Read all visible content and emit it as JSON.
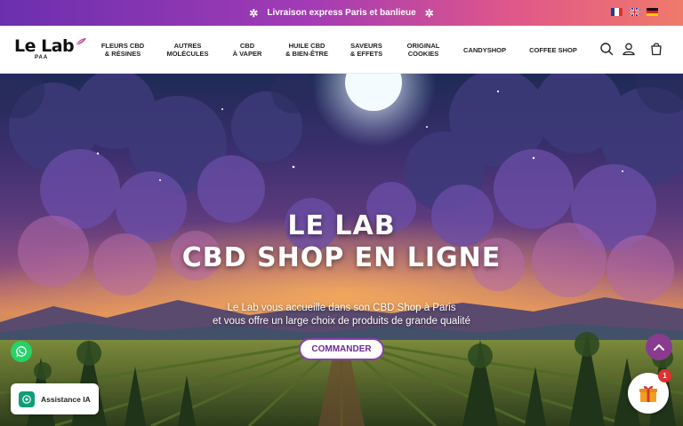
{
  "announcement": {
    "text": "Livraison express Paris et banlieue"
  },
  "languages": [
    {
      "code": "fr",
      "icon": "flag-fr-icon"
    },
    {
      "code": "en",
      "icon": "flag-uk-icon"
    },
    {
      "code": "de",
      "icon": "flag-de-icon"
    }
  ],
  "logo": {
    "main": "Le Lab",
    "sub": "PAA"
  },
  "nav": [
    {
      "line1": "Fleurs CBD",
      "line2": "& Résines"
    },
    {
      "line1": "Autres",
      "line2": "Molécules"
    },
    {
      "line1": "CBD",
      "line2": "à vaper"
    },
    {
      "line1": "Huile CBD",
      "line2": "& Bien-Être"
    },
    {
      "line1": "Saveurs",
      "line2": "& effets"
    },
    {
      "line1": "Original",
      "line2": "Cookies"
    },
    {
      "line1": "Candyshop",
      "line2": ""
    },
    {
      "line1": "Coffee Shop",
      "line2": ""
    }
  ],
  "header_icons": [
    "search-icon",
    "account-icon",
    "cart-icon"
  ],
  "hero": {
    "title_line1": "LE LAB",
    "title_line2": "CBD SHOP EN LIGNE",
    "subtitle_line1": "Le Lab vous accueille dans son CBD Shop à Paris",
    "subtitle_line2": "et vous offre un large choix de produits de grande qualité",
    "cta": "COMMANDER"
  },
  "widgets": {
    "assistant_label": "Assistance IA",
    "gift_badge": "1"
  },
  "colors": {
    "accent": "#8a3fb0",
    "whatsapp": "#25d366",
    "badge": "#e0302e"
  }
}
